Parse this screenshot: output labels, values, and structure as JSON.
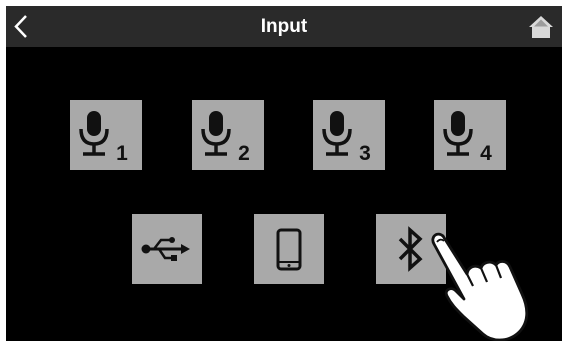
{
  "header": {
    "title": "Input",
    "back_icon": "chevron-left-icon",
    "home_icon": "home-icon"
  },
  "mic_tiles": [
    {
      "icon": "microphone-icon",
      "number": "1"
    },
    {
      "icon": "microphone-icon",
      "number": "2"
    },
    {
      "icon": "microphone-icon",
      "number": "3"
    },
    {
      "icon": "microphone-icon",
      "number": "4"
    }
  ],
  "source_tiles": [
    {
      "icon": "usb-icon"
    },
    {
      "icon": "smartphone-icon"
    },
    {
      "icon": "bluetooth-icon"
    }
  ],
  "pointer": "hand-pointer-icon",
  "colors": {
    "screen_background": "#000000",
    "header_background": "#2a2a2a",
    "tile_background": "#a9a9a9",
    "icon_color": "#111111",
    "text_color": "#ffffff"
  }
}
